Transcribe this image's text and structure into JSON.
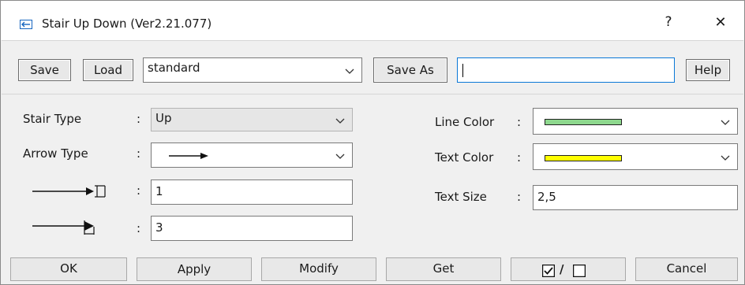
{
  "window": {
    "title": "Stair Up Down (Ver2.21.077)",
    "help_glyph": "?",
    "close_glyph": "✕"
  },
  "toolbar": {
    "save_label": "Save",
    "load_label": "Load",
    "preset_value": "standard",
    "save_as_label": "Save As",
    "save_as_value": "",
    "help_label": "Help"
  },
  "form": {
    "stair_type_label": "Stair Type",
    "stair_type_value": "Up",
    "arrow_type_label": "Arrow Type",
    "colon": ":",
    "arrow_param_1_value": "1",
    "arrow_param_2_value": "3",
    "line_color_label": "Line Color",
    "line_color_hex": "#8ed88e",
    "text_color_label": "Text Color",
    "text_color_hex": "#ffff00",
    "text_size_label": "Text Size",
    "text_size_value": "2,5"
  },
  "footer": {
    "ok_label": "OK",
    "apply_label": "Apply",
    "modify_label": "Modify",
    "get_label": "Get",
    "toggle_separator": "/",
    "cancel_label": "Cancel"
  },
  "icons": {
    "title": "back-arrow-icon",
    "dropdown": "chevron-down-icon",
    "arrow_sample": "right-arrow-icon",
    "check_on": "checked-box-icon",
    "check_off": "unchecked-box-icon"
  }
}
